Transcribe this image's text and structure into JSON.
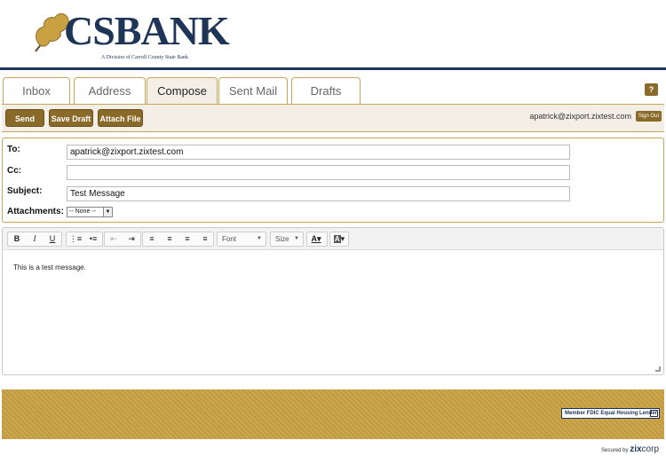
{
  "brand": {
    "name": "CSBANK",
    "subtitle": "A Division of Carroll County State Bank"
  },
  "tabs": [
    {
      "label": "Inbox"
    },
    {
      "label": "Address"
    },
    {
      "label": "Compose"
    },
    {
      "label": "Sent Mail"
    },
    {
      "label": "Drafts"
    }
  ],
  "help": {
    "label": "?"
  },
  "toolbar": {
    "send_label": "Send",
    "save_draft_label": "Save Draft",
    "attach_file_label": "Attach File",
    "user_email": "apatrick@zixport.zixtest.com",
    "sign_out_label": "Sign Out"
  },
  "form": {
    "to_label": "To:",
    "to_value": "apatrick@zixport.zixtest.com",
    "cc_label": "Cc:",
    "cc_value": "",
    "subject_label": "Subject:",
    "subject_value": "Test Message",
    "attachments_label": "Attachments:",
    "attachments_value": "-- None --"
  },
  "editor": {
    "font_label": "Font",
    "size_label": "Size",
    "body": "This is a test message."
  },
  "footer": {
    "fdic_text": "Member FDIC   Equal Housing Lender",
    "secured_by": "Secured by",
    "zix_brand": "zix",
    "zix_brand_suffix": "corp"
  },
  "colors": {
    "brand_navy": "#1e3557",
    "accent_gold": "#c9a042",
    "button_brown": "#8a6a28"
  }
}
